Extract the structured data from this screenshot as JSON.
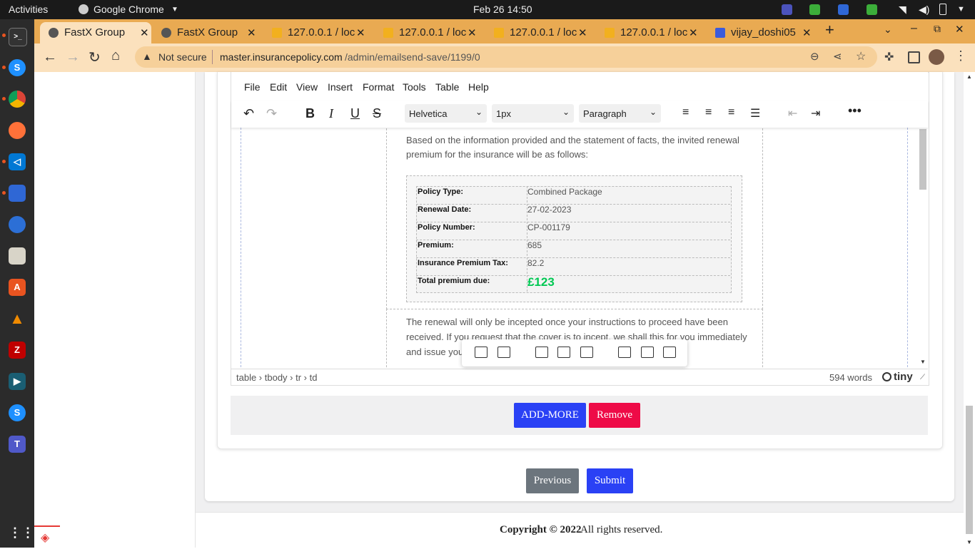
{
  "topbar": {
    "activities": "Activities",
    "app_menu": "Google Chrome",
    "clock": "Feb 26  14:50"
  },
  "browser": {
    "tabs": [
      {
        "label": "FastX Group",
        "active": true
      },
      {
        "label": "FastX Group",
        "active": false
      },
      {
        "label": "127.0.0.1 / loc",
        "active": false
      },
      {
        "label": "127.0.0.1 / loc",
        "active": false
      },
      {
        "label": "127.0.0.1 / loc",
        "active": false
      },
      {
        "label": "127.0.0.1 / loc",
        "active": false
      },
      {
        "label": "vijay_doshi05",
        "active": false
      }
    ],
    "new_tab": "+",
    "security_label": "Not secure",
    "url_host": "master.insurancepolicy.com",
    "url_path": "/admin/emailsend-save/1199/0"
  },
  "editor": {
    "menu": [
      "File",
      "Edit",
      "View",
      "Insert",
      "Format",
      "Tools",
      "Table",
      "Help"
    ],
    "font_family": "Helvetica",
    "font_size": "1px",
    "block_format": "Paragraph",
    "intro_text": "Based on the information provided and the statement of facts, the invited renewal premium for the insurance will be as follows:",
    "table_rows": [
      {
        "label": "Policy Type:",
        "value": "Combined Package"
      },
      {
        "label": "Renewal Date:",
        "value": "27-02-2023"
      },
      {
        "label": "Policy Number:",
        "value": "CP-001179"
      },
      {
        "label": "Premium:",
        "value": "685"
      },
      {
        "label": "Insurance Premium Tax:",
        "value": "82.2"
      },
      {
        "label": "Total premium due:",
        "value": "£123"
      }
    ],
    "renewal_text_1": "The renewal will only be incepted once your instructions to proceed have been",
    "renewal_text_2": "received. If you request that the cover is to incept, we shall this for you immediately",
    "renewal_text_3": "and issue you",
    "path": "table › tbody › tr › td",
    "word_count": "594 words",
    "brand": "tiny",
    "accent_color": "#00c853"
  },
  "actions": {
    "add_more": "ADD-MORE",
    "remove": "Remove",
    "previous": "Previous",
    "submit": "Submit"
  },
  "footer": {
    "copyright_prefix": "Copyright © 2022",
    "copyright_suffix": " All rights reserved."
  },
  "colors": {
    "primary": "#2a41f5",
    "danger": "#ee0b47",
    "secondary": "#6c757d",
    "chrome_tab": "#e9aa52"
  }
}
